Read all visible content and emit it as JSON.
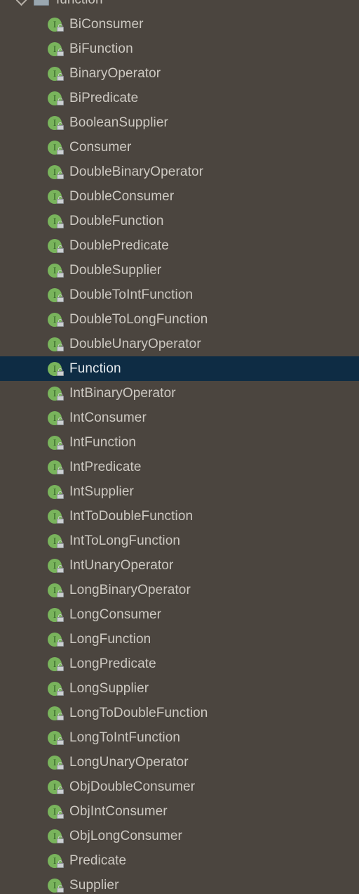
{
  "panel": {
    "name": "project-structure-tree",
    "background_color": "#4b453f",
    "selection_color": "#0e2c44",
    "text_color": "#cdc9c2",
    "interface_icon_color": "#79b45c"
  },
  "package": {
    "label": "function",
    "icon": "package-icon",
    "chevron": "chevron-down-icon",
    "expanded": true
  },
  "items": [
    {
      "label": "BiConsumer",
      "icon": "interface-locked-icon",
      "selected": false
    },
    {
      "label": "BiFunction",
      "icon": "interface-locked-icon",
      "selected": false
    },
    {
      "label": "BinaryOperator",
      "icon": "interface-locked-icon",
      "selected": false
    },
    {
      "label": "BiPredicate",
      "icon": "interface-locked-icon",
      "selected": false
    },
    {
      "label": "BooleanSupplier",
      "icon": "interface-locked-icon",
      "selected": false
    },
    {
      "label": "Consumer",
      "icon": "interface-locked-icon",
      "selected": false
    },
    {
      "label": "DoubleBinaryOperator",
      "icon": "interface-locked-icon",
      "selected": false
    },
    {
      "label": "DoubleConsumer",
      "icon": "interface-locked-icon",
      "selected": false
    },
    {
      "label": "DoubleFunction",
      "icon": "interface-locked-icon",
      "selected": false
    },
    {
      "label": "DoublePredicate",
      "icon": "interface-locked-icon",
      "selected": false
    },
    {
      "label": "DoubleSupplier",
      "icon": "interface-locked-icon",
      "selected": false
    },
    {
      "label": "DoubleToIntFunction",
      "icon": "interface-locked-icon",
      "selected": false
    },
    {
      "label": "DoubleToLongFunction",
      "icon": "interface-locked-icon",
      "selected": false
    },
    {
      "label": "DoubleUnaryOperator",
      "icon": "interface-locked-icon",
      "selected": false
    },
    {
      "label": "Function",
      "icon": "interface-locked-icon",
      "selected": true
    },
    {
      "label": "IntBinaryOperator",
      "icon": "interface-locked-icon",
      "selected": false
    },
    {
      "label": "IntConsumer",
      "icon": "interface-locked-icon",
      "selected": false
    },
    {
      "label": "IntFunction",
      "icon": "interface-locked-icon",
      "selected": false
    },
    {
      "label": "IntPredicate",
      "icon": "interface-locked-icon",
      "selected": false
    },
    {
      "label": "IntSupplier",
      "icon": "interface-locked-icon",
      "selected": false
    },
    {
      "label": "IntToDoubleFunction",
      "icon": "interface-locked-icon",
      "selected": false
    },
    {
      "label": "IntToLongFunction",
      "icon": "interface-locked-icon",
      "selected": false
    },
    {
      "label": "IntUnaryOperator",
      "icon": "interface-locked-icon",
      "selected": false
    },
    {
      "label": "LongBinaryOperator",
      "icon": "interface-locked-icon",
      "selected": false
    },
    {
      "label": "LongConsumer",
      "icon": "interface-locked-icon",
      "selected": false
    },
    {
      "label": "LongFunction",
      "icon": "interface-locked-icon",
      "selected": false
    },
    {
      "label": "LongPredicate",
      "icon": "interface-locked-icon",
      "selected": false
    },
    {
      "label": "LongSupplier",
      "icon": "interface-locked-icon",
      "selected": false
    },
    {
      "label": "LongToDoubleFunction",
      "icon": "interface-locked-icon",
      "selected": false
    },
    {
      "label": "LongToIntFunction",
      "icon": "interface-locked-icon",
      "selected": false
    },
    {
      "label": "LongUnaryOperator",
      "icon": "interface-locked-icon",
      "selected": false
    },
    {
      "label": "ObjDoubleConsumer",
      "icon": "interface-locked-icon",
      "selected": false
    },
    {
      "label": "ObjIntConsumer",
      "icon": "interface-locked-icon",
      "selected": false
    },
    {
      "label": "ObjLongConsumer",
      "icon": "interface-locked-icon",
      "selected": false
    },
    {
      "label": "Predicate",
      "icon": "interface-locked-icon",
      "selected": false
    },
    {
      "label": "Supplier",
      "icon": "interface-locked-icon",
      "selected": false
    }
  ]
}
